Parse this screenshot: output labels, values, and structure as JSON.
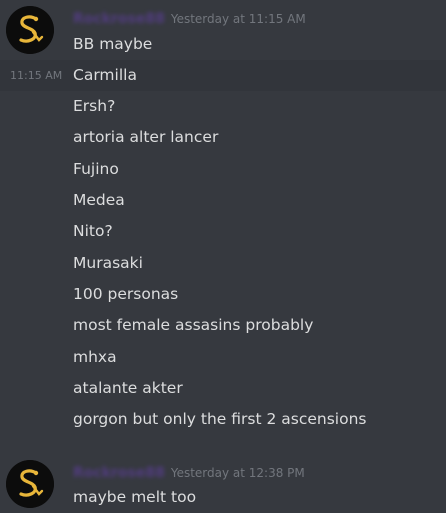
{
  "groups": [
    {
      "username": "Rockrose88",
      "timestamp": "Yesterday at 11:15 AM",
      "hover_time": "11:15 AM",
      "messages": [
        "BB maybe",
        "Carmilla",
        "Ersh?",
        "artoria alter lancer",
        "Fujino",
        "Medea",
        "Nito?",
        "Murasaki",
        "100 personas",
        "most female assasins probably",
        "mhxa",
        "atalante akter",
        "gorgon but only the first 2 ascensions"
      ]
    },
    {
      "username": "Rockrose88",
      "timestamp": "Yesterday at 12:38 PM",
      "messages": [
        "maybe melt too"
      ]
    }
  ],
  "colors": {
    "background": "#36393f",
    "hover_background": "#32353b",
    "message_text": "#dcddde",
    "timestamp": "#72767d",
    "username": "#5b3e96",
    "avatar_bg": "#0c0c0c",
    "avatar_glyph": "#e8b63a"
  },
  "icons": {
    "avatar": "snake-glyph-icon"
  }
}
